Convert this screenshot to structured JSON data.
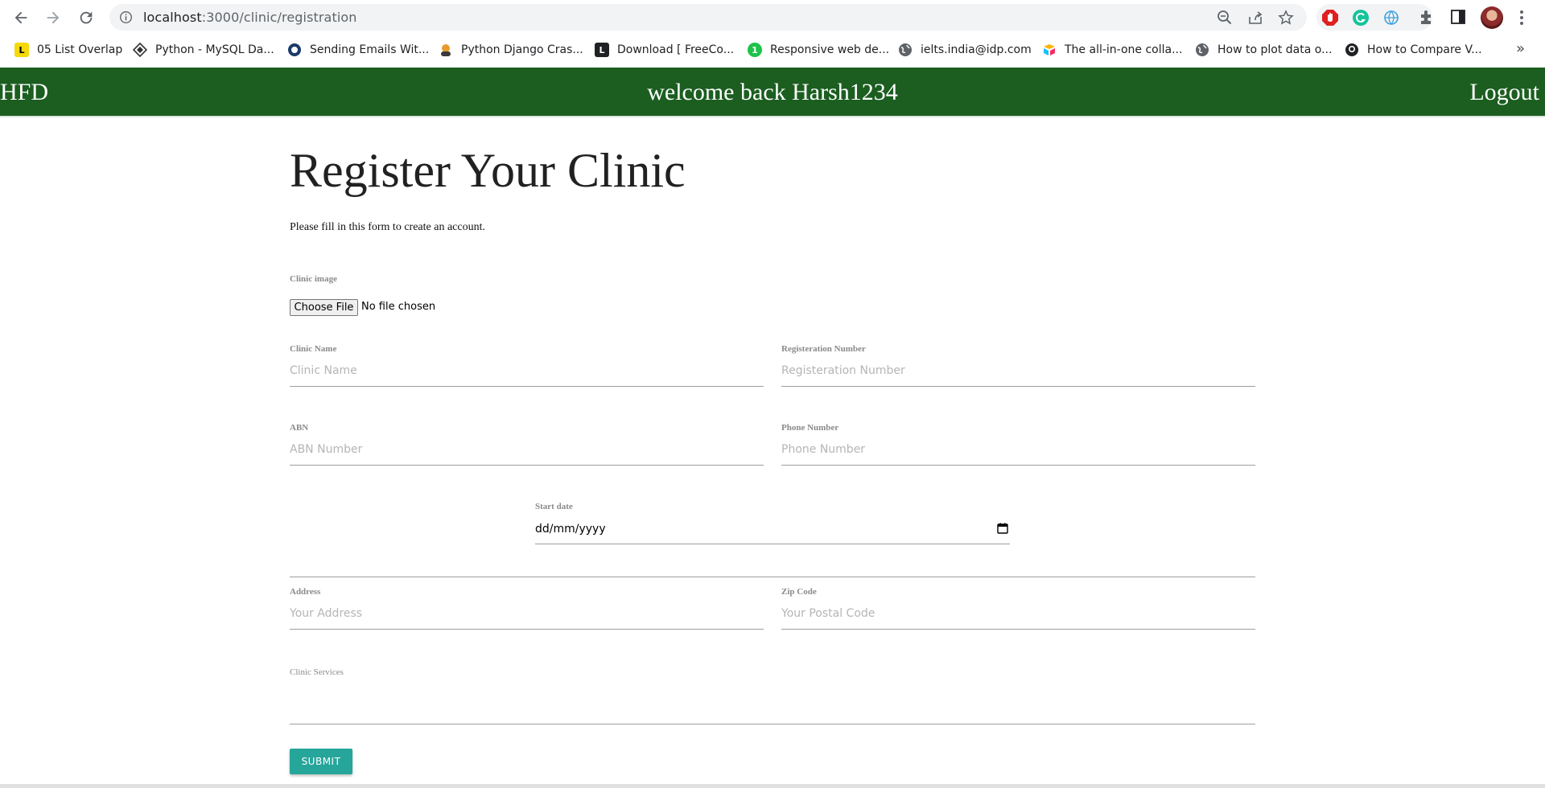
{
  "browser": {
    "url_host": "localhost",
    "url_path": ":3000/clinic/registration",
    "bookmarks": [
      {
        "label": "05 List Overlap",
        "icon": "L-badge-icon",
        "color": "#f5d90a"
      },
      {
        "label": "Python - MySQL Da...",
        "icon": "diamond-icon",
        "color": "#333333"
      },
      {
        "label": "Sending Emails Wit...",
        "icon": "circle-logo-icon",
        "color": "#1a3a6b"
      },
      {
        "label": "Python Django Cras...",
        "icon": "avatar-icon",
        "color": "#e89a2c"
      },
      {
        "label": "Download [ FreeCo...",
        "icon": "L-square-icon",
        "color": "#202124"
      },
      {
        "label": "Responsive web de...",
        "icon": "green-badge-icon",
        "color": "#1ec34a"
      },
      {
        "label": "ielts.india@idp.com",
        "icon": "globe-icon",
        "color": "#5f6368"
      },
      {
        "label": "The all-in-one colla...",
        "icon": "airtable-icon",
        "color": "#fcb400"
      },
      {
        "label": "How to plot data o...",
        "icon": "globe-icon",
        "color": "#5f6368"
      },
      {
        "label": "How to Compare V...",
        "icon": "github-icon",
        "color": "#202124"
      }
    ]
  },
  "header": {
    "brand": "HFD",
    "welcome": "welcome back Harsh1234",
    "logout": "Logout",
    "bg_color": "#1b5e20"
  },
  "form": {
    "title": "Register Your Clinic",
    "subtitle": "Please fill in this form to create an account.",
    "clinic_image": {
      "label": "Clinic image",
      "button": "Choose File",
      "status": "No file chosen"
    },
    "clinic_name": {
      "label": "Clinic Name",
      "placeholder": "Clinic Name"
    },
    "registration_number": {
      "label": "Registeration Number",
      "placeholder": "Registeration Number"
    },
    "abn": {
      "label": "ABN",
      "placeholder": "ABN Number"
    },
    "phone": {
      "label": "Phone Number",
      "placeholder": "Phone Number"
    },
    "start_date": {
      "label": "Start date",
      "value": "dd/mm/yyyy"
    },
    "address": {
      "label": "Address",
      "placeholder": "Your Address"
    },
    "zip": {
      "label": "Zip Code",
      "placeholder": "Your Postal Code"
    },
    "services": {
      "label": "Clinic Services"
    },
    "submit": "SUBMIT",
    "submit_color": "#26a69a"
  }
}
